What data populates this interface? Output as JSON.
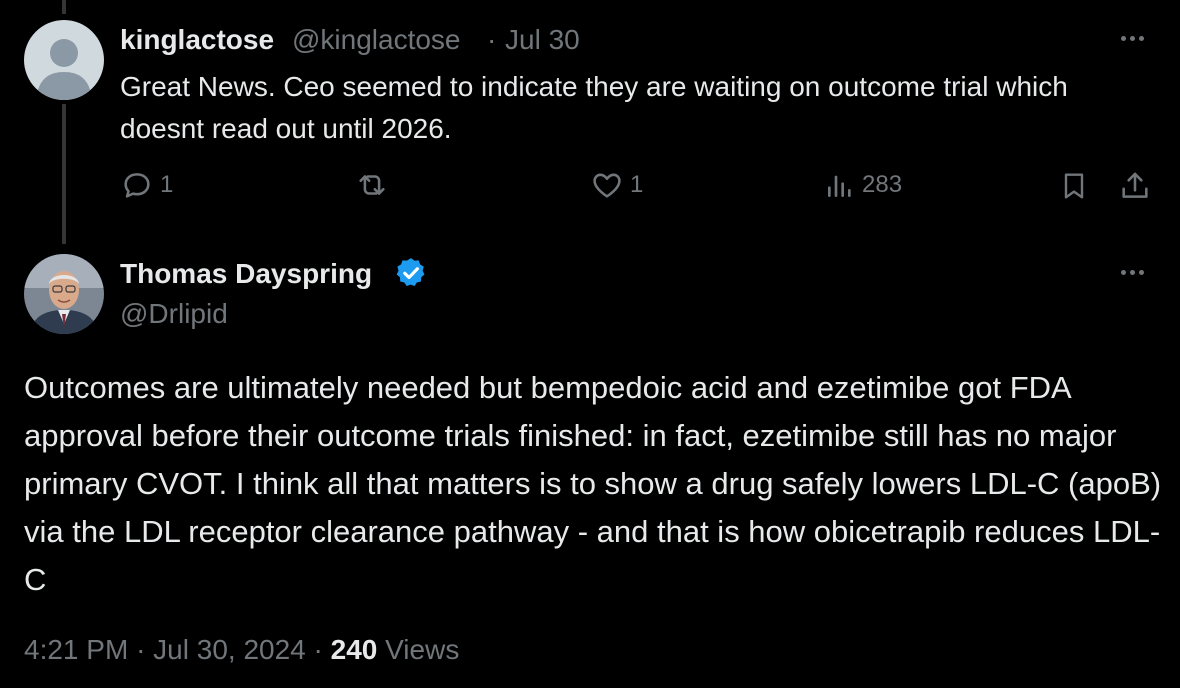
{
  "reply": {
    "display_name": "kinglactose",
    "handle": "@kinglactose",
    "separator": "·",
    "date": "Jul 30",
    "text": "Great News. Ceo seemed to indicate they are waiting on outcome trial which doesnt read out until 2026.",
    "actions": {
      "replies": "1",
      "reposts": "",
      "likes": "1",
      "views": "283"
    },
    "avatar_icon": "default-avatar-icon"
  },
  "main_tweet": {
    "display_name": "Thomas Dayspring",
    "handle": "@Drlipid",
    "verified": true,
    "text": "Outcomes are ultimately needed but bempedoic acid and ezetimibe got FDA approval before their outcome trials finished: in fact, ezetimibe still has no major primary CVOT. I think all that matters is to show a drug safely lowers LDL-C (apoB) via the LDL receptor clearance pathway - and that is how obicetrapib reduces LDL-C",
    "time": "4:21 PM",
    "date": "Jul 30, 2024",
    "separator": "·",
    "views_count": "240",
    "views_label": "Views"
  },
  "colors": {
    "background": "#000000",
    "text": "#e7e9ea",
    "muted": "#71767b",
    "verified": "#1d9bf0",
    "thread_line": "#333639"
  }
}
